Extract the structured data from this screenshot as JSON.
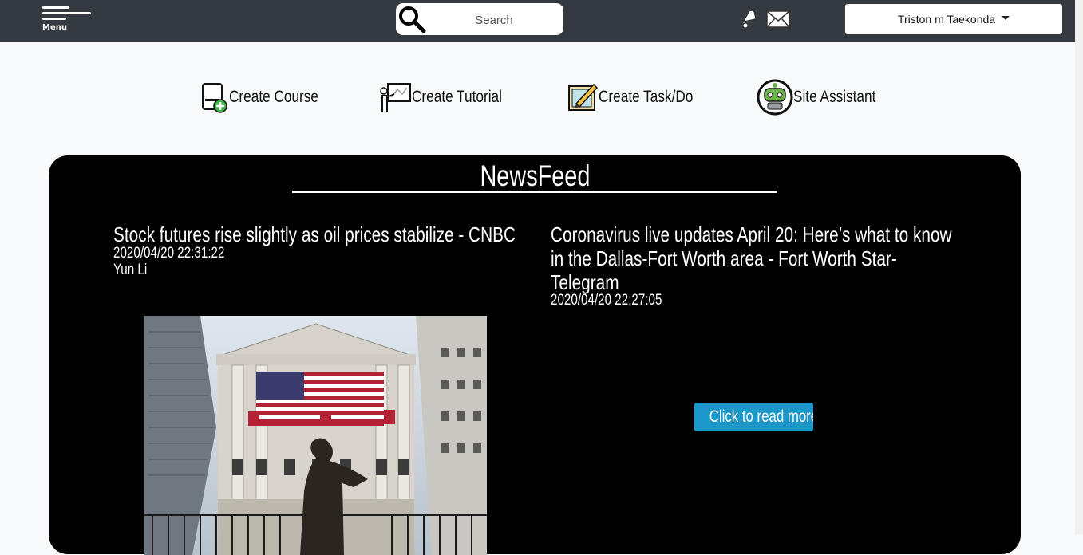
{
  "header": {
    "menu_label": "Menu",
    "search_placeholder": "Search",
    "user_name": "Triston m Taekonda"
  },
  "actions": [
    {
      "label": "Create Course",
      "icon": "course-add-icon"
    },
    {
      "label": "Create Tutorial",
      "icon": "teacher-board-icon"
    },
    {
      "label": "Create Task/Do",
      "icon": "notepad-pencil-icon"
    },
    {
      "label": "Site Assistant",
      "icon": "robot-icon"
    }
  ],
  "newsfeed": {
    "title": "NewsFeed",
    "articles": [
      {
        "title": "Stock futures rise slightly as oil prices stabilize - CNBC",
        "date": "2020/04/20 22:31:22",
        "author": "Yun Li",
        "image": "stock-exchange-photo"
      },
      {
        "title": "Coronavirus live updates April 20: Here’s what to know in the Dallas-Fort Worth area - Fort Worth Star-Telegram",
        "date": "2020/04/20 22:27:05",
        "read_more": "Click to read more..."
      }
    ]
  },
  "colors": {
    "topbar": "#343a40",
    "page_bg": "#f7f9fb",
    "newsfeed_bg": "#000000",
    "read_more_button": "#1b98c9"
  }
}
